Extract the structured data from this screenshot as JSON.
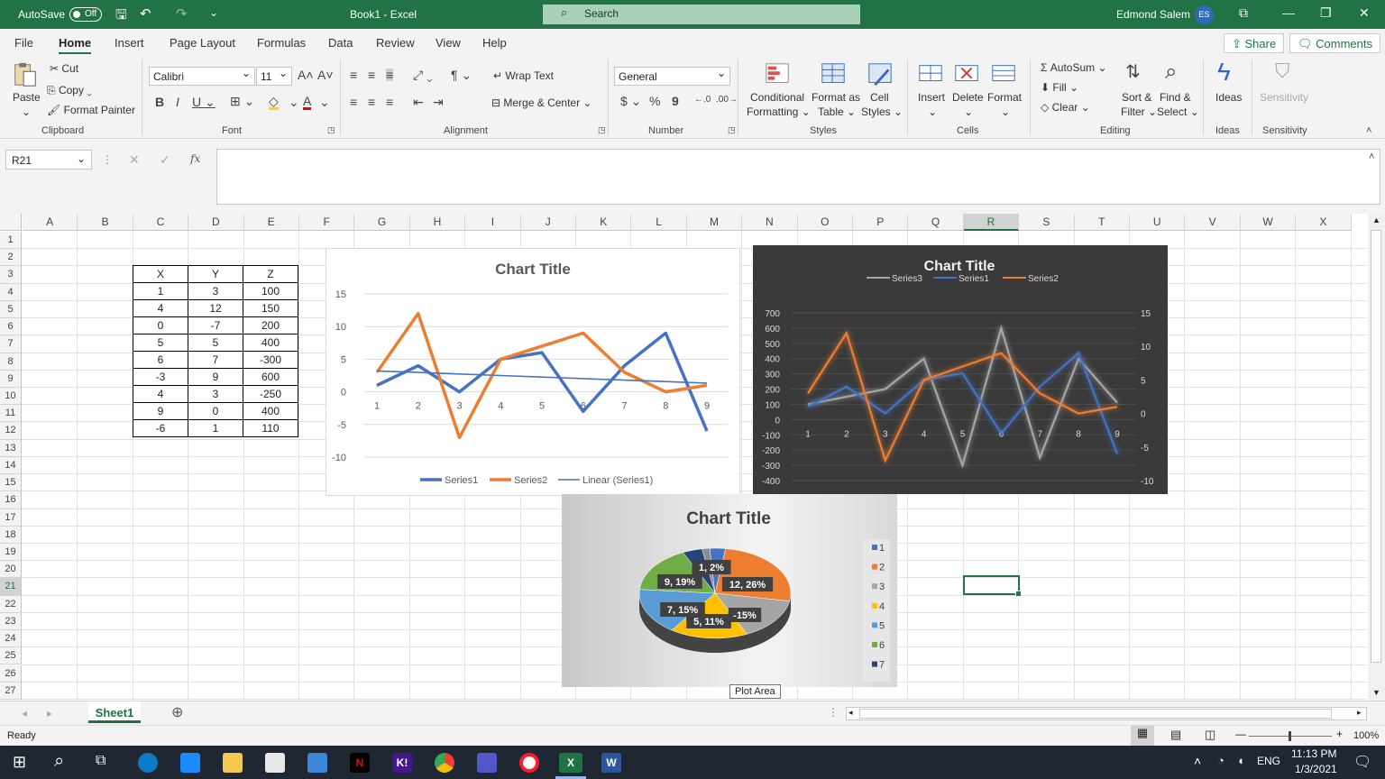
{
  "titlebar": {
    "autosave_label": "AutoSave",
    "autosave_state": "Off",
    "doc_title": "Book1  -  Excel",
    "search_placeholder": "Search",
    "user_name": "Edmond Salem",
    "user_initials": "ES"
  },
  "tabs": [
    "File",
    "Home",
    "Insert",
    "Page Layout",
    "Formulas",
    "Data",
    "Review",
    "View",
    "Help"
  ],
  "active_tab": "Home",
  "share_label": "Share",
  "comments_label": "Comments",
  "ribbon": {
    "clipboard": {
      "paste": "Paste",
      "cut": "Cut",
      "copy": "Copy",
      "format_painter": "Format Painter",
      "group": "Clipboard"
    },
    "font": {
      "name": "Calibri",
      "size": "11",
      "group": "Font"
    },
    "alignment": {
      "wrap_text": "Wrap Text",
      "merge_center": "Merge & Center",
      "group": "Alignment"
    },
    "number": {
      "format": "General",
      "group": "Number"
    },
    "styles": {
      "conditional": "Conditional",
      "formatting": "Formatting",
      "format_as": "Format as",
      "table": "Table",
      "cell": "Cell",
      "cell_styles": "Styles",
      "group": "Styles"
    },
    "cells": {
      "insert": "Insert",
      "delete": "Delete",
      "format": "Format",
      "group": "Cells"
    },
    "editing": {
      "autosum": "AutoSum",
      "fill": "Fill",
      "clear": "Clear",
      "sort": "Sort &",
      "filter": "Filter",
      "find": "Find &",
      "select": "Select",
      "group": "Editing"
    },
    "ideas": {
      "label": "Ideas",
      "group": "Ideas"
    },
    "sensitivity": {
      "label": "Sensitivity",
      "group": "Sensitivity"
    }
  },
  "namebox": "R21",
  "fx_label": "fx",
  "columns": [
    "A",
    "B",
    "C",
    "D",
    "E",
    "F",
    "G",
    "H",
    "I",
    "J",
    "K",
    "L",
    "M",
    "N",
    "O",
    "P",
    "Q",
    "R",
    "S",
    "T",
    "U",
    "V",
    "W",
    "X"
  ],
  "selected_column": "R",
  "rows": [
    "1",
    "2",
    "3",
    "4",
    "5",
    "6",
    "7",
    "8",
    "9",
    "10",
    "11",
    "12",
    "13",
    "14",
    "15",
    "16",
    "17",
    "18",
    "19",
    "20",
    "21",
    "22",
    "23",
    "24",
    "25",
    "26",
    "27"
  ],
  "selected_row": "21",
  "table": {
    "headers": [
      "X",
      "Y",
      "Z"
    ],
    "rows": [
      [
        "1",
        "3",
        "100"
      ],
      [
        "4",
        "12",
        "150"
      ],
      [
        "0",
        "-7",
        "200"
      ],
      [
        "5",
        "5",
        "400"
      ],
      [
        "6",
        "7",
        "-300"
      ],
      [
        "-3",
        "9",
        "600"
      ],
      [
        "4",
        "3",
        "-250"
      ],
      [
        "9",
        "0",
        "400"
      ],
      [
        "-6",
        "1",
        "110"
      ]
    ]
  },
  "chart_data": [
    {
      "type": "line",
      "title": "Chart Title",
      "categories": [
        "1",
        "2",
        "3",
        "4",
        "5",
        "6",
        "7",
        "8",
        "9"
      ],
      "series": [
        {
          "name": "Series1",
          "values": [
            1,
            4,
            0,
            5,
            6,
            -3,
            4,
            9,
            -6
          ],
          "color": "#4472c4"
        },
        {
          "name": "Series2",
          "values": [
            3,
            12,
            -7,
            5,
            7,
            9,
            3,
            0,
            1
          ],
          "color": "#ed7d31"
        },
        {
          "name": "Linear (Series1)",
          "values": [
            3.2,
            2.97,
            2.73,
            2.5,
            2.27,
            2.03,
            1.8,
            1.57,
            1.33
          ],
          "color": "#4472c4"
        }
      ],
      "ylim": [
        -10,
        15
      ],
      "yticks": [
        "15",
        "10",
        "5",
        "0",
        "-5",
        "-10"
      ],
      "legend": "bottom"
    },
    {
      "type": "line",
      "title": "Chart Title",
      "categories": [
        "1",
        "2",
        "3",
        "4",
        "5",
        "6",
        "7",
        "8",
        "9"
      ],
      "series": [
        {
          "name": "Series3",
          "values": [
            100,
            150,
            200,
            400,
            -300,
            600,
            -250,
            400,
            110
          ],
          "color": "#a5a5a5",
          "axis": "left"
        },
        {
          "name": "Series1",
          "values": [
            1,
            4,
            0,
            5,
            6,
            -3,
            4,
            9,
            -6
          ],
          "color": "#4472c4",
          "axis": "right"
        },
        {
          "name": "Series2",
          "values": [
            3,
            12,
            -7,
            5,
            7,
            9,
            3,
            0,
            1
          ],
          "color": "#ed7d31",
          "axis": "right"
        }
      ],
      "ylim_left": [
        -400,
        700
      ],
      "ylim_right": [
        -10,
        15
      ],
      "yticks_left": [
        "700",
        "600",
        "500",
        "400",
        "300",
        "200",
        "100",
        "0",
        "-100",
        "-200",
        "-300",
        "-400"
      ],
      "yticks_right": [
        "15",
        "10",
        "5",
        "0",
        "-5",
        "-10"
      ],
      "legend": "top"
    },
    {
      "type": "pie",
      "title": "Chart Title",
      "legend": [
        "1",
        "2",
        "3",
        "4",
        "5",
        "6",
        "7"
      ],
      "data_labels": [
        "1, 2%",
        "12, 26%",
        "-15%",
        "5, 11%",
        "7, 15%",
        "9, 19%"
      ]
    }
  ],
  "tooltip": "Plot Area",
  "sheet_tab": "Sheet1",
  "status": "Ready",
  "zoom": "100%",
  "clock": {
    "time": "11:13 PM",
    "date": "1/3/2021"
  },
  "lang": "ENG"
}
